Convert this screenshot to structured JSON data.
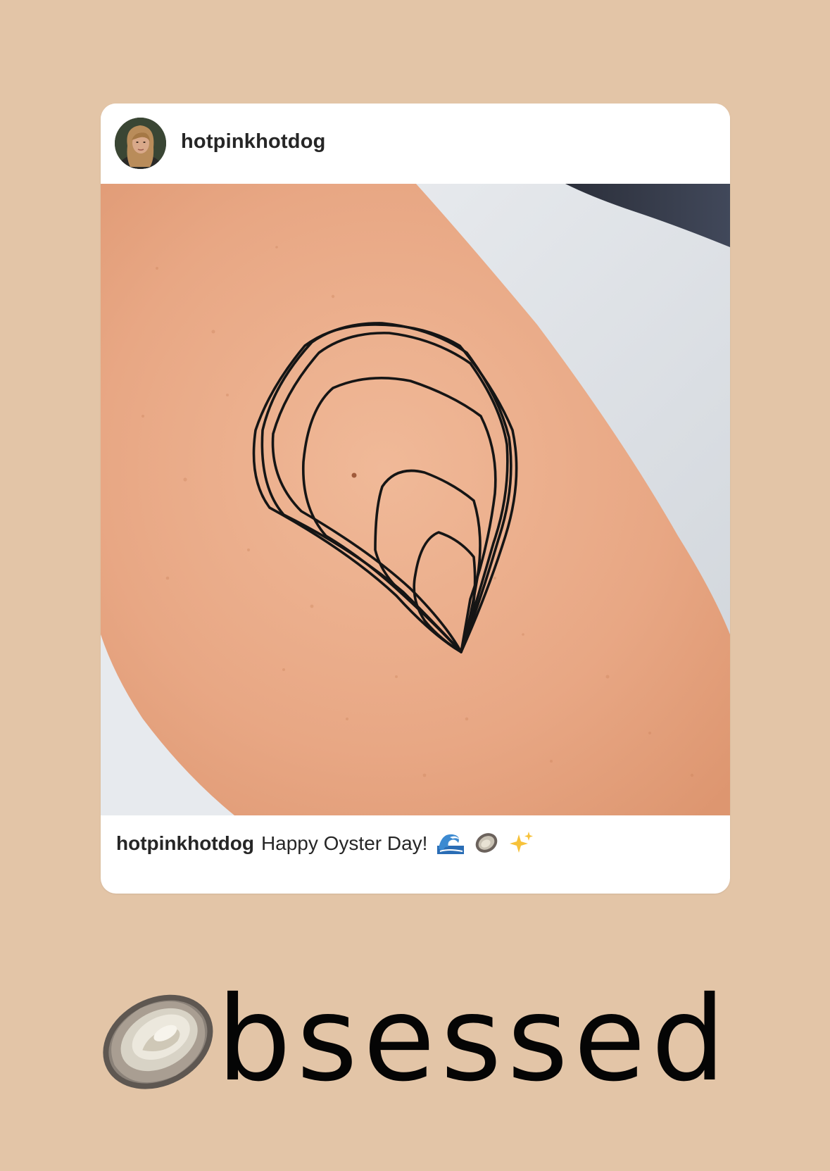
{
  "colors": {
    "background": "#e3c5a7",
    "card": "#ffffff",
    "text": "#262626",
    "sticker_text": "#050505"
  },
  "post": {
    "username": "hotpinkhotdog",
    "caption": {
      "username": "hotpinkhotdog",
      "text": "Happy Oyster Day!",
      "emojis": [
        "wave-icon",
        "oyster-icon",
        "sparkles-icon"
      ]
    }
  },
  "sticker": {
    "icon": "oyster-icon",
    "text": "bsessed"
  }
}
